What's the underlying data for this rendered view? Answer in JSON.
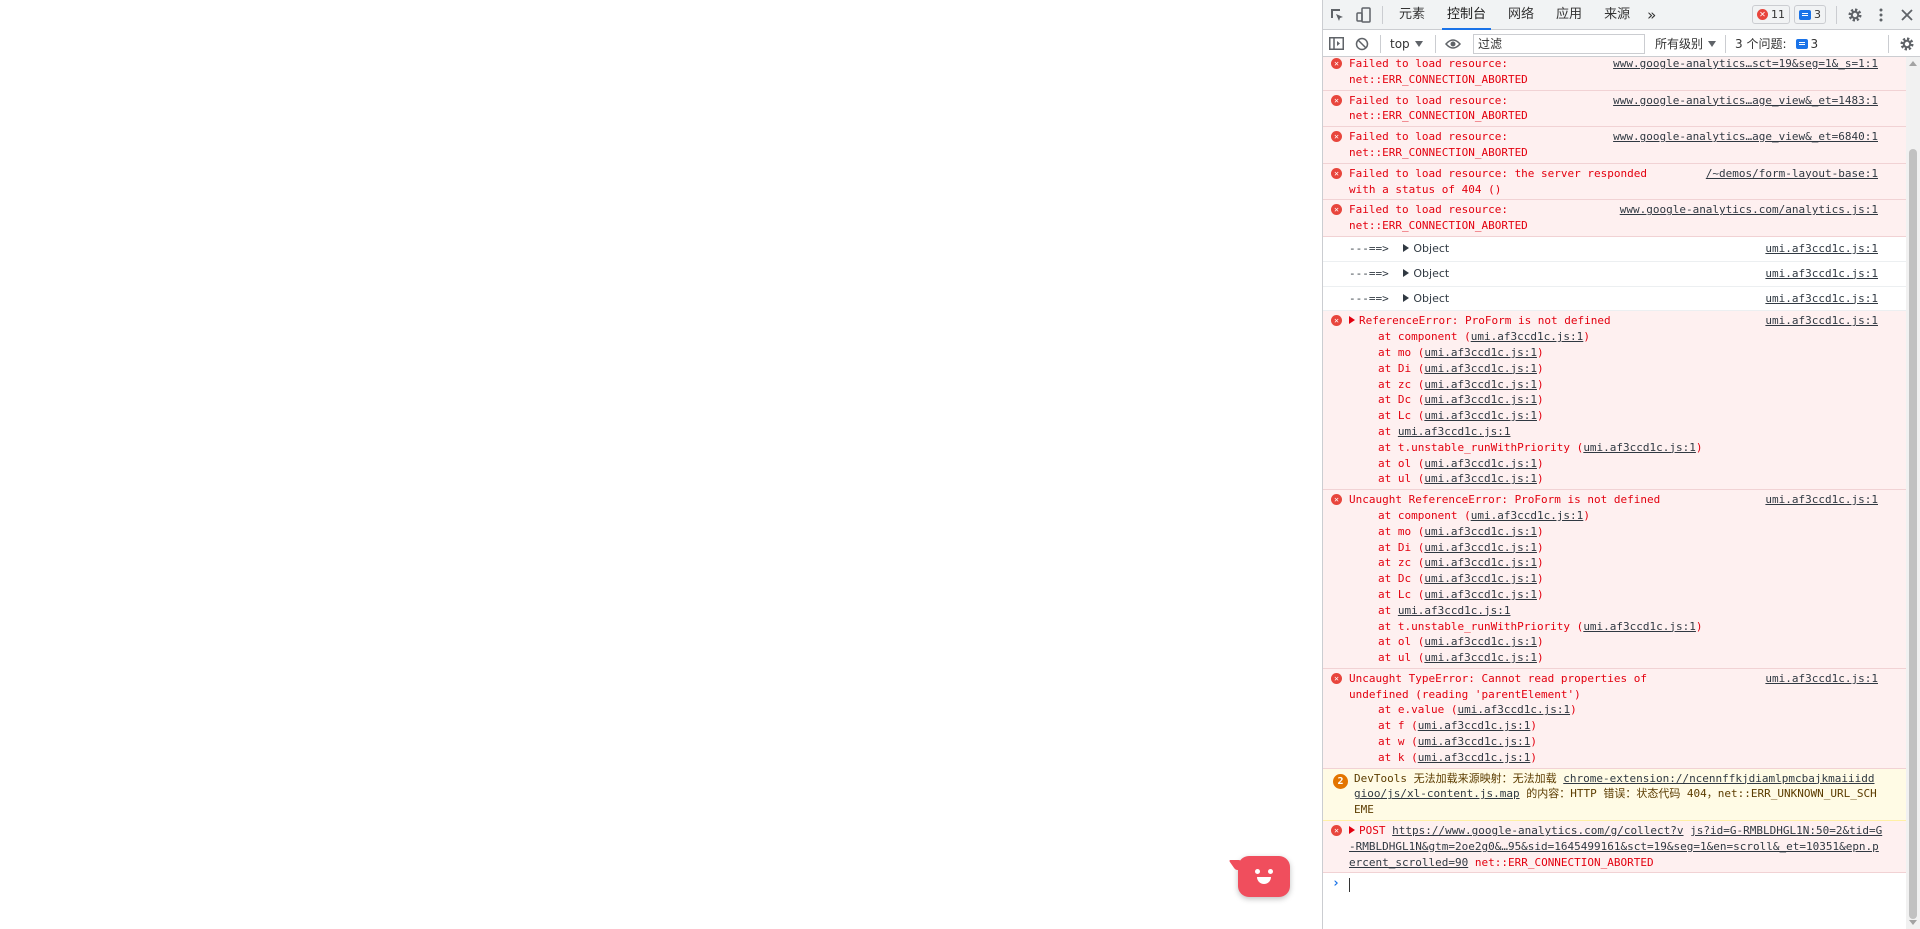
{
  "devtools": {
    "tabs": [
      {
        "label": "元素"
      },
      {
        "label": "控制台"
      },
      {
        "label": "网络"
      },
      {
        "label": "应用"
      },
      {
        "label": "来源"
      }
    ],
    "more_tabs": "»",
    "error_count": "11",
    "message_count": "3",
    "toolbar": {
      "context": "top",
      "filter_placeholder": "过滤",
      "levels": "所有级别",
      "issues_label": "3 个问题:",
      "issues_count": "3"
    }
  },
  "console": {
    "messages": [
      {
        "type": "error",
        "text": "Failed to load resource:\nnet::ERR_CONNECTION_ABORTED",
        "source": "www.google-analytics…sct=19&seg=1&_s=1:1"
      },
      {
        "type": "error",
        "text": "Failed to load resource:\nnet::ERR_CONNECTION_ABORTED",
        "source": "www.google-analytics…age_view&_et=1483:1"
      },
      {
        "type": "error",
        "text": "Failed to load resource:\nnet::ERR_CONNECTION_ABORTED",
        "source": "www.google-analytics…age_view&_et=6840:1"
      },
      {
        "type": "error",
        "text": "Failed to load resource: the server responded\nwith a status of 404 ()",
        "source": "/~demos/form-layout-base:1"
      },
      {
        "type": "error",
        "text": "Failed to load resource:\nnet::ERR_CONNECTION_ABORTED",
        "source": "www.google-analytics.com/analytics.js:1"
      }
    ],
    "logs": [
      {
        "prefix": "---==>",
        "value": "Object",
        "source": "umi.af3ccd1c.js:1"
      },
      {
        "prefix": "---==>",
        "value": "Object",
        "source": "umi.af3ccd1c.js:1"
      },
      {
        "prefix": "---==>",
        "value": "Object",
        "source": "umi.af3ccd1c.js:1"
      }
    ],
    "ref_error": {
      "title": "ReferenceError: ProForm is not defined",
      "source": "umi.af3ccd1c.js:1",
      "stack": [
        {
          "fn": "at component (",
          "loc": "umi.af3ccd1c.js:1",
          "end": ")"
        },
        {
          "fn": "at mo (",
          "loc": "umi.af3ccd1c.js:1",
          "end": ")"
        },
        {
          "fn": "at Di (",
          "loc": "umi.af3ccd1c.js:1",
          "end": ")"
        },
        {
          "fn": "at zc (",
          "loc": "umi.af3ccd1c.js:1",
          "end": ")"
        },
        {
          "fn": "at Dc (",
          "loc": "umi.af3ccd1c.js:1",
          "end": ")"
        },
        {
          "fn": "at Lc (",
          "loc": "umi.af3ccd1c.js:1",
          "end": ")"
        },
        {
          "fn": "at ",
          "loc": "umi.af3ccd1c.js:1",
          "end": ""
        },
        {
          "fn": "at t.unstable_runWithPriority (",
          "loc": "umi.af3ccd1c.js:1",
          "end": ")"
        },
        {
          "fn": "at ol (",
          "loc": "umi.af3ccd1c.js:1",
          "end": ")"
        },
        {
          "fn": "at ul (",
          "loc": "umi.af3ccd1c.js:1",
          "end": ")"
        }
      ]
    },
    "uncaught_ref": {
      "title": "Uncaught ReferenceError: ProForm is not defined",
      "source": "umi.af3ccd1c.js:1",
      "stack": [
        {
          "fn": "at component (",
          "loc": "umi.af3ccd1c.js:1",
          "end": ")"
        },
        {
          "fn": "at mo (",
          "loc": "umi.af3ccd1c.js:1",
          "end": ")"
        },
        {
          "fn": "at Di (",
          "loc": "umi.af3ccd1c.js:1",
          "end": ")"
        },
        {
          "fn": "at zc (",
          "loc": "umi.af3ccd1c.js:1",
          "end": ")"
        },
        {
          "fn": "at Dc (",
          "loc": "umi.af3ccd1c.js:1",
          "end": ")"
        },
        {
          "fn": "at Lc (",
          "loc": "umi.af3ccd1c.js:1",
          "end": ")"
        },
        {
          "fn": "at ",
          "loc": "umi.af3ccd1c.js:1",
          "end": ""
        },
        {
          "fn": "at t.unstable_runWithPriority (",
          "loc": "umi.af3ccd1c.js:1",
          "end": ")"
        },
        {
          "fn": "at ol (",
          "loc": "umi.af3ccd1c.js:1",
          "end": ")"
        },
        {
          "fn": "at ul (",
          "loc": "umi.af3ccd1c.js:1",
          "end": ")"
        }
      ]
    },
    "type_error": {
      "title": "Uncaught TypeError: Cannot read properties of\nundefined (reading 'parentElement')",
      "source": "umi.af3ccd1c.js:1",
      "stack": [
        {
          "fn": "at e.value (",
          "loc": "umi.af3ccd1c.js:1",
          "end": ")"
        },
        {
          "fn": "at f (",
          "loc": "umi.af3ccd1c.js:1",
          "end": ")"
        },
        {
          "fn": "at w (",
          "loc": "umi.af3ccd1c.js:1",
          "end": ")"
        },
        {
          "fn": "at k (",
          "loc": "umi.af3ccd1c.js:1",
          "end": ")"
        }
      ]
    },
    "warning": {
      "count": "2",
      "prefix": "DevTools 无法加载来源映射：无法加载 ",
      "link": "chrome-extension://ncennffkjdiamlpmcbajkmaiiiddgioo/js/xl-content.js.map",
      "suffix": " 的内容：HTTP 错误：状态代码 404，net::ERR_UNKNOWN_URL_SCHEME"
    },
    "post_error": {
      "method": "POST ",
      "url": "https://www.google-analytics.com/g/collect?v",
      "url_tail": "js?id=G-RMBLDHGL1N:50",
      "cont": "=2&tid=G-RMBLDHGL1N&gtm=2oe2g0&…95&sid=1645499161&sct=19&seg=1&en=scroll&_et=10351&epn.percent_scrolled=90",
      "status": " net::ERR_CONNECTION_ABORTED"
    },
    "prompt_symbol": "›"
  },
  "colors": {
    "error": "#e3000f",
    "accent": "#1a73e8",
    "bot": "#f04e5d"
  }
}
